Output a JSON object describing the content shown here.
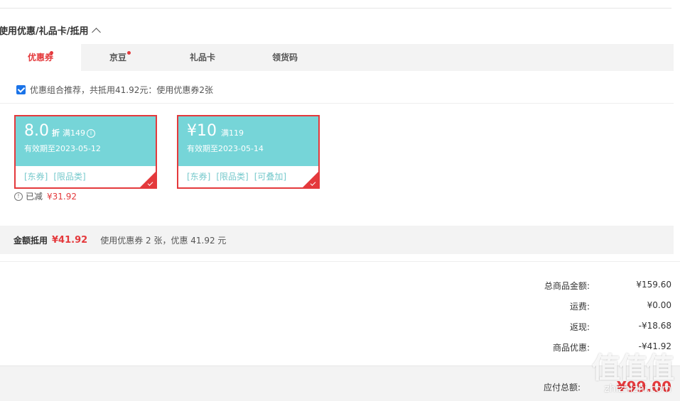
{
  "section": {
    "title": "使用优惠/礼品卡/抵用"
  },
  "tabs": [
    {
      "label": "优惠券",
      "active": true,
      "dot": true
    },
    {
      "label": "京豆",
      "active": false,
      "dot": true
    },
    {
      "label": "礼品卡",
      "active": false,
      "dot": false
    },
    {
      "label": "领货码",
      "active": false,
      "dot": false
    }
  ],
  "combo": {
    "checked": true,
    "text": "优惠组合推荐，共抵用41.92元：使用优惠券2张"
  },
  "coupons": [
    {
      "amount": "8.0",
      "unit": "折",
      "cond": "满149",
      "expiry": "有效期至2023-05-12",
      "tags": [
        "[东券]",
        "[限品类]"
      ],
      "selected": true
    },
    {
      "amount": "¥10",
      "unit": "",
      "cond": "满119",
      "expiry": "有效期至2023-05-14",
      "tags": [
        "[东券]",
        "[限品类]",
        "[可叠加]"
      ],
      "selected": true
    }
  ],
  "saved": {
    "label": "已减",
    "value": "¥31.92"
  },
  "summary": {
    "label": "金额抵用",
    "amount": "¥41.92",
    "desc": "使用优惠券 2 张，优惠 41.92 元"
  },
  "totals": [
    {
      "key": "总商品金额:",
      "value": "¥159.60"
    },
    {
      "key": "运费:",
      "value": "¥0.00"
    },
    {
      "key": "返现:",
      "value": "-¥18.68"
    },
    {
      "key": "商品优惠:",
      "value": "-¥41.92"
    }
  ],
  "payable": {
    "key": "应付总额:",
    "value": "¥99.00"
  },
  "watermark": {
    "main": "值值值",
    "sub": "zhizhizhi.com"
  },
  "colors": {
    "accent": "#e4393c",
    "coupon_bg": "#76d5d8"
  }
}
